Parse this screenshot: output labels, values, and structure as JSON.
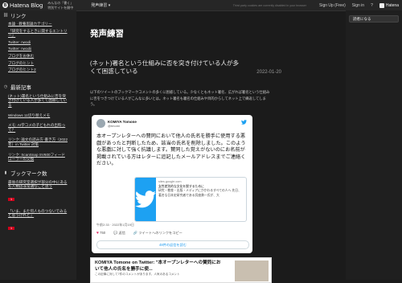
{
  "topbar": {
    "logo": "Hatena Blog",
    "tagline_1": "みんなの「書く」",
    "tagline_2": "特別サイトを開中",
    "menu": "発声練習",
    "tiny_text": "Third party cookies are currently disabled in your browser",
    "signup": "Sign Up (Free)",
    "signin": "Sign in",
    "brand": "Hatena"
  },
  "sidebar": {
    "links_heading": "リンク",
    "links": [
      "本論 · 教養思論カテゴリー",
      "「研究をするときに関するエントリー」",
      "Twitter: nwodi",
      "Twitter: nwodii",
      "ブログをお休む",
      "ブログのヒント",
      "ブログのヒント2"
    ],
    "recent_heading": "最新記事",
    "recent": [
      {
        "title": "(ネット)署名という仕組みに否を突き付けている人が多くて困惑している",
        "date": ""
      },
      {
        "title": "Windows 11切り替えメモ",
        "date": ""
      },
      {
        "title": "メモ: AI学コメの子どもれの出料って？",
        "date": ""
      },
      {
        "title": "リンク: 論文の読み方·書き方（2022年）in Twitter 対策",
        "date": ""
      },
      {
        "title": "リンク: ScanSnap SV600フィードローラーの交換",
        "date": ""
      }
    ],
    "bookmark_heading": "ブックマーク数",
    "bookmarks": [
      {
        "title": "最後の研究室選択が部分の中にあるも人類は非常識なこと思う",
        "count": "1"
      },
      {
        "title": "「いま、また何人ものつないでみると思うけれど」",
        "count": "1"
      }
    ]
  },
  "main": {
    "blog_title": "発声練習",
    "post_title": "(ネット)署名という仕組みに否を突き付けている人が多くて困惑している",
    "post_date": "2022-01-20",
    "post_text": "以下のツイートのブックマークコメントの多くに困惑している。少なくともネット署名、広がれば署名という仕組みに否をつきつけている人がこんなに多いとは。ネット署名も署名の仕組みや目的からしてネット上で繰返してしまう。",
    "tweet": {
      "name": "KOMIYA Tomone",
      "handle": "@tmomi",
      "body": "本オープンレターへの賛同において他人の氏名を勝手に使用する悪戯があったと判断したため、該当の氏名を削除しました。このような悪戯に対して強く抗議します。賛同した覚えがないのにお名前が掲載されている方はレターに追記したメールアドレスまでご連絡ください。",
      "card_domain": "sites.google.com",
      "card_title": "女性差別的な文化を脱するために",
      "card_desc": "研究・教育・出版・メディアにかかわるすべての人へ 先日、著名な日本史研究者である呉座勇一氏が、大",
      "time": "午前2:33 · 2022年1月19日",
      "likes": "750",
      "reply": "返信",
      "copy": "ツイートへのリンクをコピー",
      "read_replies": "48件の返信を読む"
    },
    "embed": {
      "title": "KOMIYA Tomone on Twitter: \"本オープンレターへの賛同において他人の氏名を勝手に使...",
      "sub": "この記事に対して7件のコメントがあります。人気のあるコメント"
    }
  },
  "right": {
    "subscribe": "読者になる"
  },
  "colors": {
    "bg": "#1b1b1b",
    "twitter_blue": "#1da1f2",
    "badge_red": "#d0021b"
  }
}
